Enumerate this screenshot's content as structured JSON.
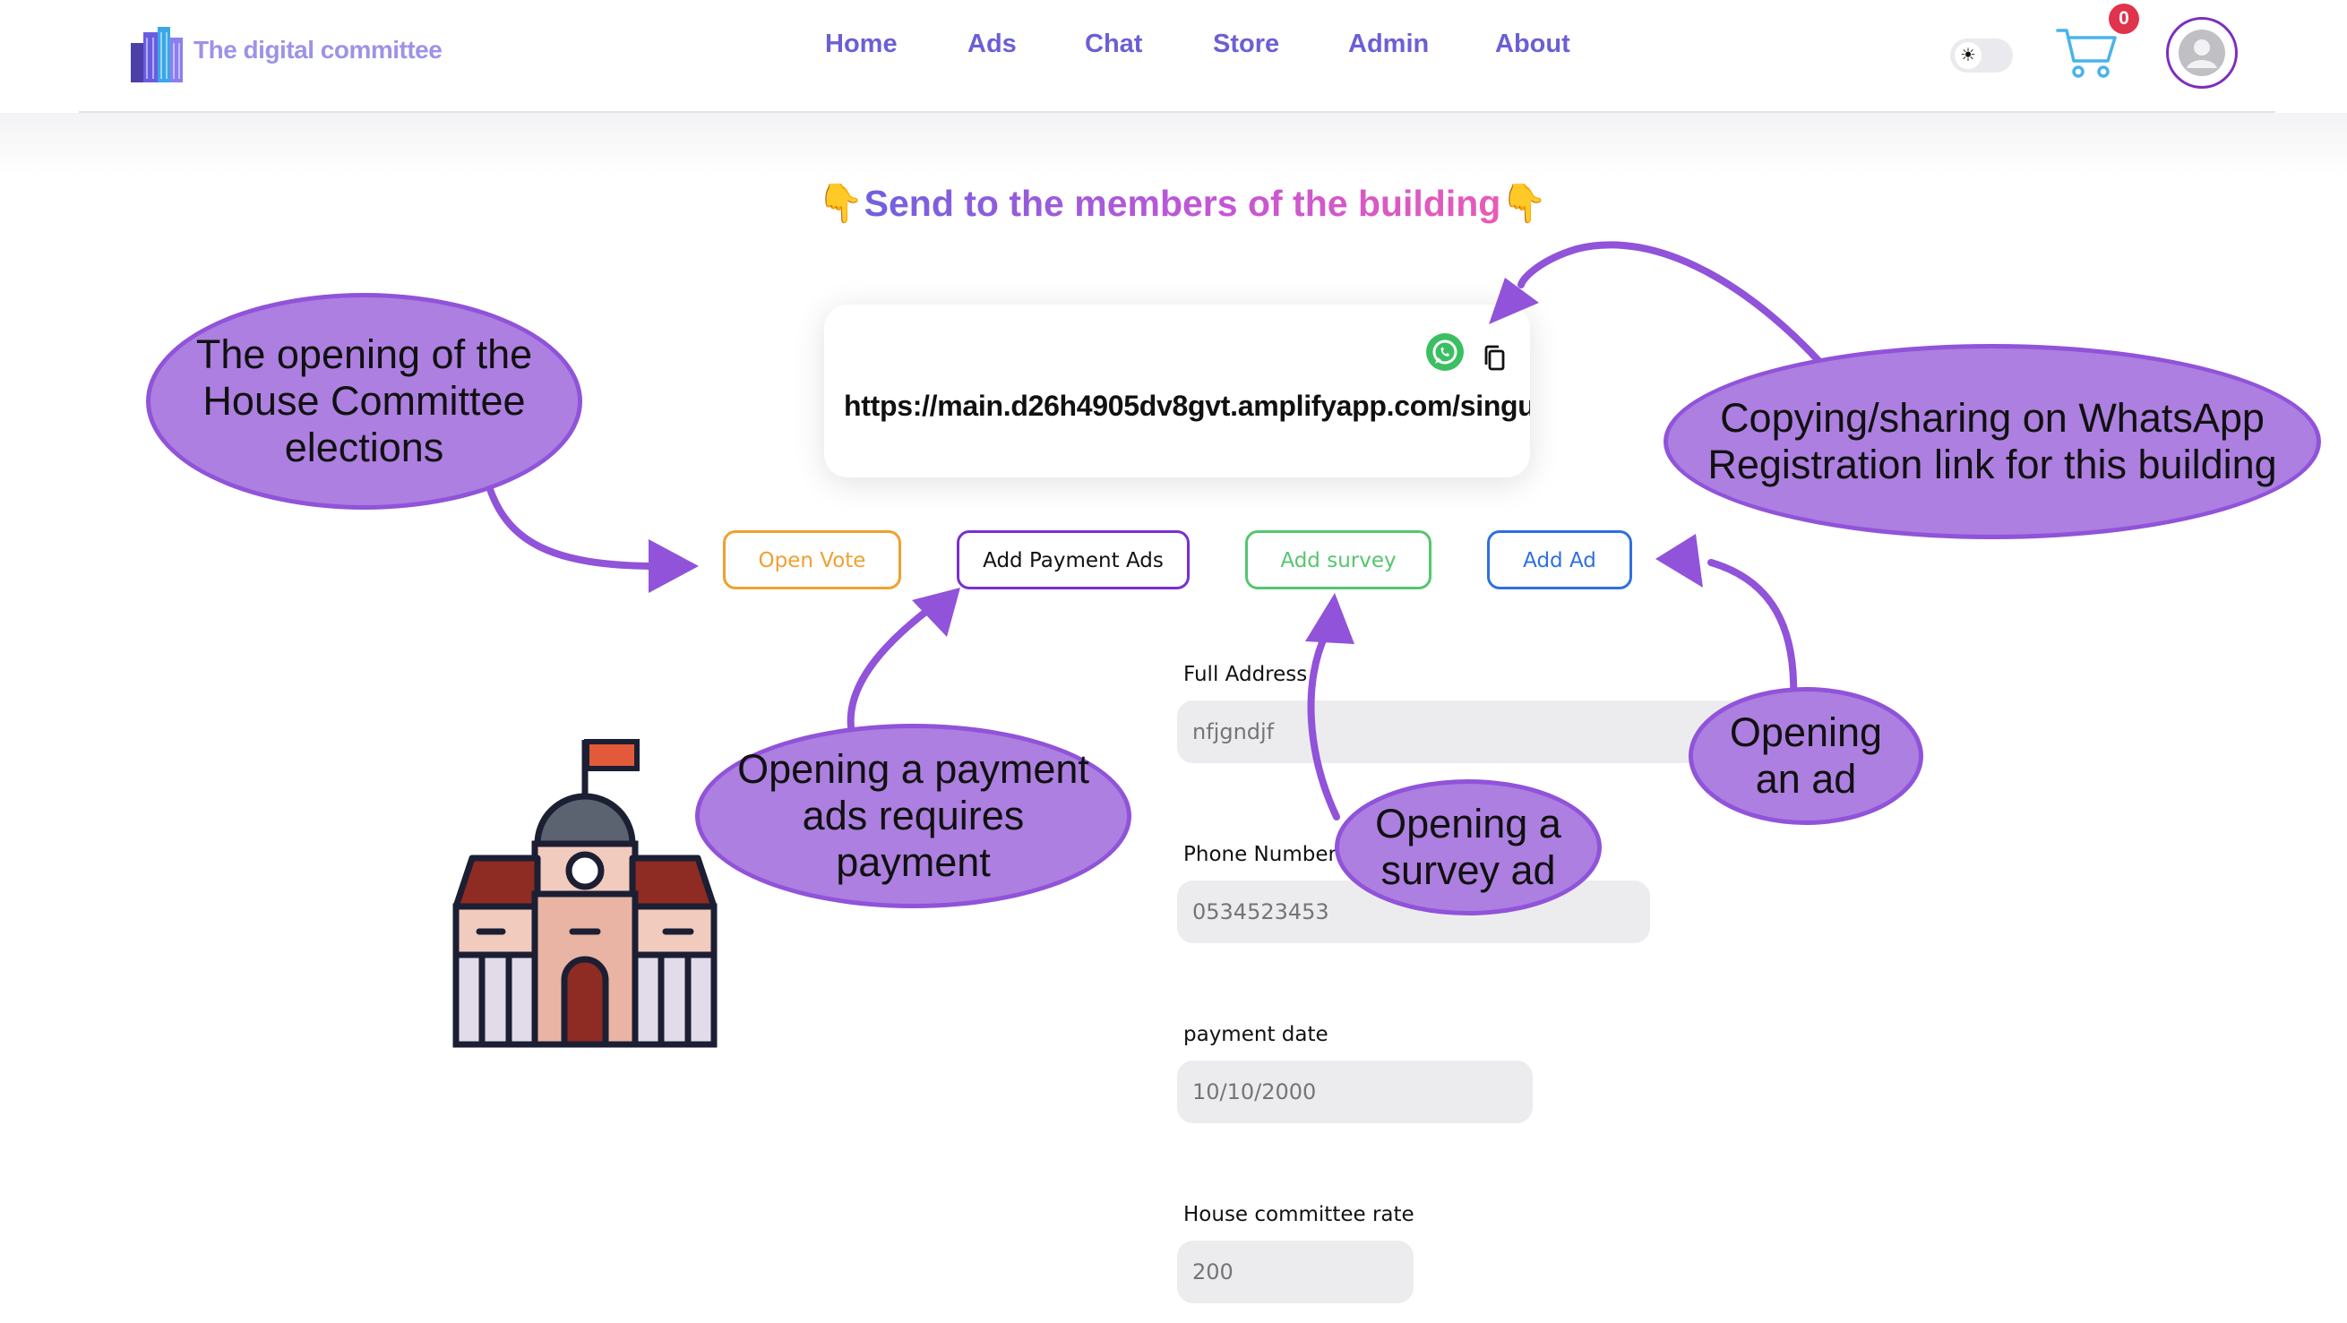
{
  "header": {
    "logo_text": "The digital committee",
    "nav": [
      "Home",
      "Ads",
      "Chat",
      "Store",
      "Admin",
      "About"
    ],
    "cart_count": "0",
    "theme_icon": "sun-icon"
  },
  "share": {
    "title": "Send to the members of the building",
    "link": "https://main.d26h4905dv8gvt.amplifyapp.com/singu"
  },
  "buttons": {
    "open_vote": "Open Vote",
    "add_payment_ads": "Add Payment Ads",
    "add_survey": "Add survey",
    "add_ad": "Add Ad"
  },
  "form": {
    "full_address": {
      "label": "Full Address",
      "placeholder": "nfjgndjf"
    },
    "phone_number": {
      "label": "Phone Number",
      "placeholder": "0534523453"
    },
    "payment_date": {
      "label": "payment date",
      "placeholder": "10/10/2000"
    },
    "house_committee_rate": {
      "label": "House committee rate",
      "placeholder": "200"
    }
  },
  "annotations": {
    "elections": "The opening of the House Committee elections",
    "whatsapp": "Copying/sharing on WhatsApp Registration link for this building",
    "payment": "Opening a payment ads requires payment",
    "survey": "Opening a survey ad",
    "ad": "Opening an ad"
  },
  "colors": {
    "brand_purple": "#6b5fd6",
    "bubble_fill": "#ac7fe0",
    "bubble_border": "#9053d9",
    "vote_orange": "#f0a030",
    "survey_green": "#55c66f",
    "ad_blue": "#2f6fe0",
    "badge_red": "#e0334c"
  }
}
